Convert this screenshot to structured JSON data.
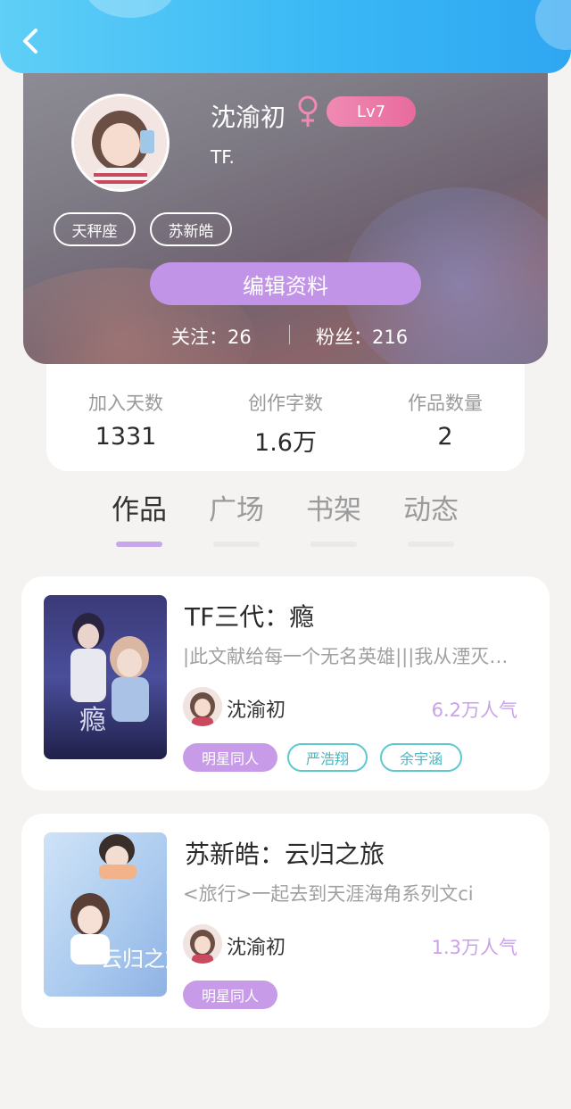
{
  "header": {
    "back_icon": "chevron-left-icon"
  },
  "profile": {
    "name": "沈渝初",
    "gender_symbol": "♀",
    "level": "Lv7",
    "signature": "TF.",
    "tags": [
      "天秤座",
      "苏新皓"
    ],
    "edit_button": "编辑资料",
    "following": "关注：26",
    "followers": "粉丝：216"
  },
  "stats": [
    {
      "label": "加入天数",
      "value": "1331"
    },
    {
      "label": "创作字数",
      "value": "1.6万"
    },
    {
      "label": "作品数量",
      "value": "2"
    }
  ],
  "tabs": [
    {
      "label": "作品",
      "active": true
    },
    {
      "label": "广场",
      "active": false
    },
    {
      "label": "书架",
      "active": false
    },
    {
      "label": "动态",
      "active": false
    }
  ],
  "works": [
    {
      "title": "TF三代：瘾",
      "description": "|此文献给每一个无名英雄|||我从湮灭里醒来",
      "author": "沈渝初",
      "popularity": "6.2万人气",
      "tags": [
        "明星同人",
        "严浩翔",
        "余宇涵"
      ],
      "cover_text": "瘾"
    },
    {
      "title": "苏新皓：云归之旅",
      "description": "<旅行>一起去到天涯海角系列文ci",
      "author": "沈渝初",
      "popularity": "1.3万人气",
      "tags": [
        "明星同人"
      ],
      "cover_text": "云归之旅"
    }
  ],
  "colors": {
    "accent_purple": "#c194e8",
    "header_blue": "#38b7f5",
    "teal": "#5ec8cf",
    "level_pink": "#e86b9e"
  }
}
